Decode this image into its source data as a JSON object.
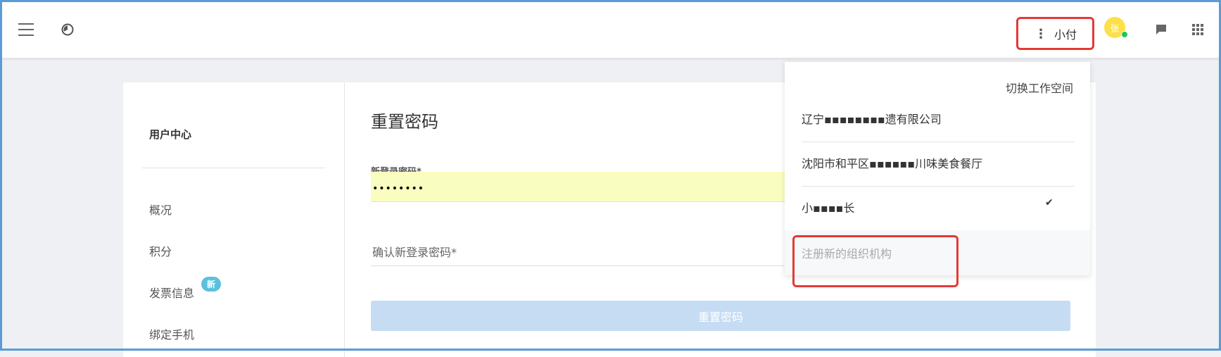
{
  "topbar": {
    "user_name": "小付",
    "avatar_text": "张"
  },
  "sidebar": {
    "title": "用户中心",
    "items": [
      {
        "label": "概况"
      },
      {
        "label": "积分"
      },
      {
        "label": "发票信息",
        "badge": "新"
      },
      {
        "label": "绑定手机"
      }
    ]
  },
  "main": {
    "title": "重置密码",
    "new_password_label": "新登录密码*",
    "new_password_value": "••••••••",
    "confirm_placeholder": "确认新登录密码*",
    "reset_button": "重置密码"
  },
  "dropdown": {
    "header": "切换工作空间",
    "workspaces": [
      {
        "label": "辽宁▪▪▪▪▪▪▪▪遗有限公司",
        "selected": false
      },
      {
        "label": "沈阳市和平区▪▪▪▪▪▪川味美食餐厅",
        "selected": false
      },
      {
        "label": "小▪▪▪▪长",
        "selected": true
      }
    ],
    "register": "注册新的组织机构",
    "check_mark": "✔"
  },
  "colors": {
    "frame": "#5b9bd5",
    "highlight": "#e53935",
    "badge": "#5bc0de",
    "autofill": "#fafdc0",
    "button_disabled": "#c5dcf3"
  }
}
